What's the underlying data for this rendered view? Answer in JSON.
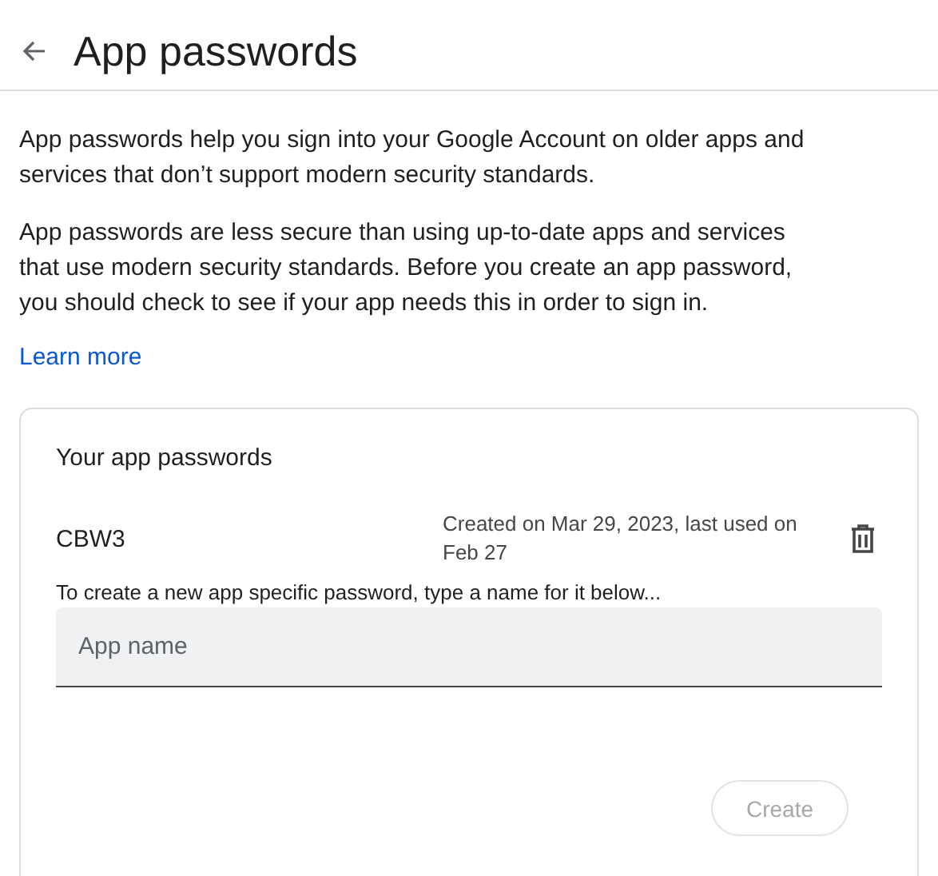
{
  "header": {
    "title": "App passwords"
  },
  "intro": [
    "App passwords help you sign into your Google Account on older apps and services that don’t support modern security standards.",
    "App passwords are less secure than using up-to-date apps and services that use modern security standards. Before you create an app password, you should check to see if your app needs this in order to sign in."
  ],
  "learn_more": "Learn more",
  "card": {
    "title": "Your app passwords",
    "passwords": [
      {
        "name": "CBW3",
        "details": "Created on Mar 29, 2023, last used on Feb 27"
      }
    ],
    "hint": "To create a new app specific password, type a name for it below...",
    "field": {
      "placeholder": "App name"
    },
    "create_button": {
      "label": "Create",
      "disabled": true
    }
  }
}
